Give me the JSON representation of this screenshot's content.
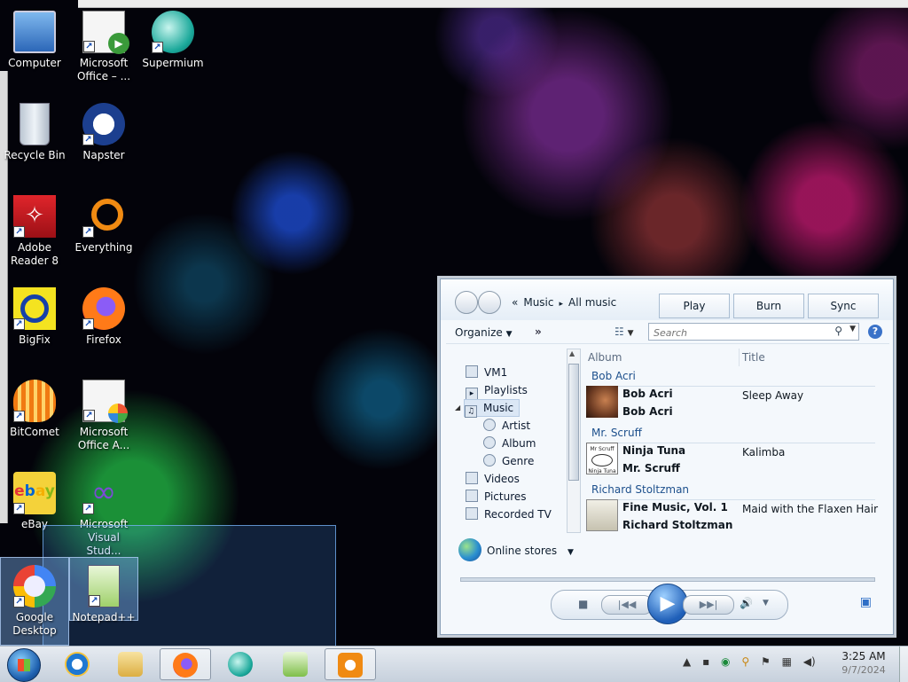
{
  "desktop": {
    "icons": [
      {
        "label": "Computer",
        "icon": "computer-icon"
      },
      {
        "label": "Microsoft Office – ...",
        "icon": "office-icon"
      },
      {
        "label": "Supermium",
        "icon": "supermium-icon"
      },
      {
        "label": "Recycle Bin",
        "icon": "recycle-bin-icon"
      },
      {
        "label": "Napster",
        "icon": "napster-icon"
      },
      {
        "label": "Adobe Reader 8",
        "icon": "adobe-reader-icon"
      },
      {
        "label": "Everything",
        "icon": "everything-icon"
      },
      {
        "label": "BigFix",
        "icon": "bigfix-icon"
      },
      {
        "label": "Firefox",
        "icon": "firefox-icon"
      },
      {
        "label": "BitComet",
        "icon": "bitcomet-icon"
      },
      {
        "label": "Microsoft Office A...",
        "icon": "office-icon"
      },
      {
        "label": "eBay",
        "icon": "ebay-icon"
      },
      {
        "label": "Microsoft Visual Stud...",
        "icon": "visual-studio-icon"
      },
      {
        "label": "Google Desktop",
        "icon": "google-desktop-icon"
      },
      {
        "label": "Notepad++",
        "icon": "notepad-plus-icon"
      }
    ]
  },
  "player": {
    "breadcrumb": [
      "«",
      "Music",
      "▸",
      "All music"
    ],
    "tabs": {
      "play": "Play",
      "burn": "Burn",
      "sync": "Sync"
    },
    "toolbar": {
      "organize": "Organize",
      "more": "»"
    },
    "search": {
      "placeholder": "Search"
    },
    "nav": {
      "vm1": "VM1",
      "playlists": "Playlists",
      "music": "Music",
      "artist": "Artist",
      "album": "Album",
      "genre": "Genre",
      "videos": "Videos",
      "pictures": "Pictures",
      "recorded_tv": "Recorded TV"
    },
    "columns": {
      "album": "Album",
      "title": "Title"
    },
    "groups": [
      {
        "artist": "Bob Acri",
        "album": "Bob Acri",
        "album_artist": "Bob Acri",
        "song": "Sleep Away"
      },
      {
        "artist": "Mr. Scruff",
        "album": "Ninja Tuna",
        "album_artist": "Mr. Scruff",
        "song": "Kalimba"
      },
      {
        "artist": "Richard Stoltzman",
        "album": "Fine Music, Vol. 1",
        "album_artist": "Richard Stoltzman",
        "song": "Maid with the Flaxen Hair"
      }
    ],
    "thumb_labels": {
      "ninja": "Mr Scruff",
      "ninja_sub": "Ninja Tuna"
    },
    "online_stores": "Online stores"
  },
  "taskbar": {
    "time": "3:25 AM",
    "date": "9/7/2024"
  }
}
